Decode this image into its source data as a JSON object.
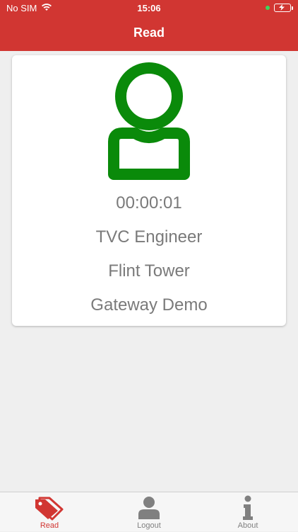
{
  "status_bar": {
    "carrier": "No SIM",
    "time": "15:06"
  },
  "header": {
    "title": "Read"
  },
  "card": {
    "timer": "00:00:01",
    "lines": [
      "TVC Engineer",
      "Flint Tower",
      "Gateway Demo"
    ]
  },
  "tabbar": {
    "tabs": [
      {
        "label": "Read",
        "icon": "tag-icon",
        "active": true
      },
      {
        "label": "Logout",
        "icon": "user-icon",
        "active": false
      },
      {
        "label": "About",
        "icon": "info-icon",
        "active": false
      }
    ]
  },
  "colors": {
    "brand_red": "#d13632",
    "avatar_green": "#0a8a0a",
    "text_gray": "#7a7a7a",
    "inactive_tab_gray": "#808080"
  }
}
